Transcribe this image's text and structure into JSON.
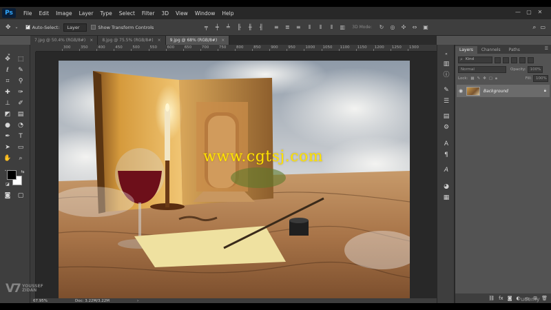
{
  "app": {
    "logo": "Ps"
  },
  "menu": [
    "File",
    "Edit",
    "Image",
    "Layer",
    "Type",
    "Select",
    "Filter",
    "3D",
    "View",
    "Window",
    "Help"
  ],
  "window_controls": [
    "—",
    "▢",
    "✕"
  ],
  "options": {
    "auto_select_label": "Auto-Select:",
    "auto_select_target": "Layer",
    "show_transform_label": "Show Transform Controls",
    "mode_3d_label": "3D Mode:"
  },
  "tabs": [
    {
      "label": "7.jpg @ 50.4% (RGB/8#)"
    },
    {
      "label": "8.jpg @ 75.5% (RGB/8#)"
    },
    {
      "label": "9.jpg @ 68% (RGB/8#)"
    }
  ],
  "tab_close": "×",
  "ruler_ticks": [
    "300",
    "350",
    "400",
    "450",
    "500",
    "550",
    "600",
    "650",
    "700",
    "750",
    "800",
    "850",
    "900",
    "950",
    "1000",
    "1050",
    "1100",
    "1150",
    "1200",
    "1250",
    "1300"
  ],
  "canvas_text": "www.cgtsj.com",
  "status": {
    "zoom": "67.95%",
    "doc": "Doc: 3.22M/3.22M",
    "arrow": "›"
  },
  "layers_panel": {
    "tabs": [
      "Layers",
      "Channels",
      "Paths"
    ],
    "kind": "Kind",
    "blend_mode": "Normal",
    "opacity_label": "Opacity:",
    "opacity_value": "100%",
    "lock_label": "Lock:",
    "fill_label": "Fill:",
    "fill_value": "100%",
    "layer_name": "Background"
  },
  "brand": {
    "mark": "V7",
    "line1": "YOUSSEF",
    "line2": "ZIDAN"
  },
  "udemy": "udemy",
  "colors": {
    "accent": "#31a8ff",
    "watermark": "#ffe400",
    "bg_ui": "#535353"
  }
}
